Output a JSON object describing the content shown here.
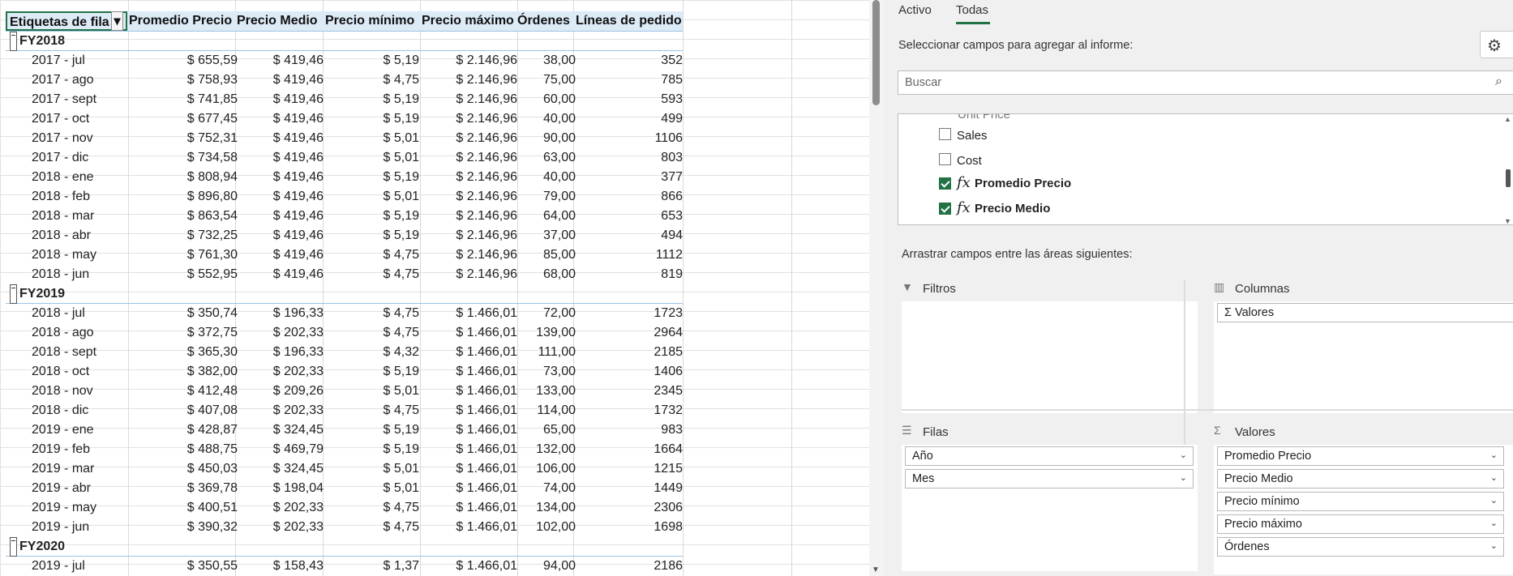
{
  "pivot": {
    "headers": [
      "Etiquetas de fila",
      "Promedio Precio",
      "Precio Medio",
      "Precio mínimo",
      "Precio máximo",
      "Órdenes",
      "Líneas de pedido"
    ],
    "rows": [
      {
        "type": "group",
        "label": "FY2018"
      },
      {
        "type": "data",
        "label": "2017 - jul",
        "c1": "$ 655,59",
        "c2": "$ 419,46",
        "c3": "$ 5,19",
        "c4": "$ 2.146,96",
        "c5": "38,00",
        "c6": "352"
      },
      {
        "type": "data",
        "label": "2017 - ago",
        "c1": "$ 758,93",
        "c2": "$ 419,46",
        "c3": "$ 4,75",
        "c4": "$ 2.146,96",
        "c5": "75,00",
        "c6": "785"
      },
      {
        "type": "data",
        "label": "2017 - sept",
        "c1": "$ 741,85",
        "c2": "$ 419,46",
        "c3": "$ 5,19",
        "c4": "$ 2.146,96",
        "c5": "60,00",
        "c6": "593"
      },
      {
        "type": "data",
        "label": "2017 - oct",
        "c1": "$ 677,45",
        "c2": "$ 419,46",
        "c3": "$ 5,19",
        "c4": "$ 2.146,96",
        "c5": "40,00",
        "c6": "499"
      },
      {
        "type": "data",
        "label": "2017 - nov",
        "c1": "$ 752,31",
        "c2": "$ 419,46",
        "c3": "$ 5,01",
        "c4": "$ 2.146,96",
        "c5": "90,00",
        "c6": "1106"
      },
      {
        "type": "data",
        "label": "2017 - dic",
        "c1": "$ 734,58",
        "c2": "$ 419,46",
        "c3": "$ 5,01",
        "c4": "$ 2.146,96",
        "c5": "63,00",
        "c6": "803"
      },
      {
        "type": "data",
        "label": "2018 - ene",
        "c1": "$ 808,94",
        "c2": "$ 419,46",
        "c3": "$ 5,19",
        "c4": "$ 2.146,96",
        "c5": "40,00",
        "c6": "377"
      },
      {
        "type": "data",
        "label": "2018 - feb",
        "c1": "$ 896,80",
        "c2": "$ 419,46",
        "c3": "$ 5,01",
        "c4": "$ 2.146,96",
        "c5": "79,00",
        "c6": "866"
      },
      {
        "type": "data",
        "label": "2018 - mar",
        "c1": "$ 863,54",
        "c2": "$ 419,46",
        "c3": "$ 5,19",
        "c4": "$ 2.146,96",
        "c5": "64,00",
        "c6": "653"
      },
      {
        "type": "data",
        "label": "2018 - abr",
        "c1": "$ 732,25",
        "c2": "$ 419,46",
        "c3": "$ 5,19",
        "c4": "$ 2.146,96",
        "c5": "37,00",
        "c6": "494"
      },
      {
        "type": "data",
        "label": "2018 - may",
        "c1": "$ 761,30",
        "c2": "$ 419,46",
        "c3": "$ 4,75",
        "c4": "$ 2.146,96",
        "c5": "85,00",
        "c6": "1112"
      },
      {
        "type": "data",
        "label": "2018 - jun",
        "c1": "$ 552,95",
        "c2": "$ 419,46",
        "c3": "$ 4,75",
        "c4": "$ 2.146,96",
        "c5": "68,00",
        "c6": "819"
      },
      {
        "type": "group",
        "label": "FY2019"
      },
      {
        "type": "data",
        "label": "2018 - jul",
        "c1": "$ 350,74",
        "c2": "$ 196,33",
        "c3": "$ 4,75",
        "c4": "$ 1.466,01",
        "c5": "72,00",
        "c6": "1723"
      },
      {
        "type": "data",
        "label": "2018 - ago",
        "c1": "$ 372,75",
        "c2": "$ 202,33",
        "c3": "$ 4,75",
        "c4": "$ 1.466,01",
        "c5": "139,00",
        "c6": "2964"
      },
      {
        "type": "data",
        "label": "2018 - sept",
        "c1": "$ 365,30",
        "c2": "$ 196,33",
        "c3": "$ 4,32",
        "c4": "$ 1.466,01",
        "c5": "111,00",
        "c6": "2185"
      },
      {
        "type": "data",
        "label": "2018 - oct",
        "c1": "$ 382,00",
        "c2": "$ 202,33",
        "c3": "$ 5,19",
        "c4": "$ 1.466,01",
        "c5": "73,00",
        "c6": "1406"
      },
      {
        "type": "data",
        "label": "2018 - nov",
        "c1": "$ 412,48",
        "c2": "$ 209,26",
        "c3": "$ 5,01",
        "c4": "$ 1.466,01",
        "c5": "133,00",
        "c6": "2345"
      },
      {
        "type": "data",
        "label": "2018 - dic",
        "c1": "$ 407,08",
        "c2": "$ 202,33",
        "c3": "$ 4,75",
        "c4": "$ 1.466,01",
        "c5": "114,00",
        "c6": "1732"
      },
      {
        "type": "data",
        "label": "2019 - ene",
        "c1": "$ 428,87",
        "c2": "$ 324,45",
        "c3": "$ 5,19",
        "c4": "$ 1.466,01",
        "c5": "65,00",
        "c6": "983"
      },
      {
        "type": "data",
        "label": "2019 - feb",
        "c1": "$ 488,75",
        "c2": "$ 469,79",
        "c3": "$ 5,19",
        "c4": "$ 1.466,01",
        "c5": "132,00",
        "c6": "1664"
      },
      {
        "type": "data",
        "label": "2019 - mar",
        "c1": "$ 450,03",
        "c2": "$ 324,45",
        "c3": "$ 5,01",
        "c4": "$ 1.466,01",
        "c5": "106,00",
        "c6": "1215"
      },
      {
        "type": "data",
        "label": "2019 - abr",
        "c1": "$ 369,78",
        "c2": "$ 198,04",
        "c3": "$ 5,01",
        "c4": "$ 1.466,01",
        "c5": "74,00",
        "c6": "1449"
      },
      {
        "type": "data",
        "label": "2019 - may",
        "c1": "$ 400,51",
        "c2": "$ 202,33",
        "c3": "$ 4,75",
        "c4": "$ 1.466,01",
        "c5": "134,00",
        "c6": "2306"
      },
      {
        "type": "data",
        "label": "2019 - jun",
        "c1": "$ 390,32",
        "c2": "$ 202,33",
        "c3": "$ 4,75",
        "c4": "$ 1.466,01",
        "c5": "102,00",
        "c6": "1698"
      },
      {
        "type": "group",
        "label": "FY2020"
      },
      {
        "type": "data",
        "label": "2019 - jul",
        "c1": "$ 350,55",
        "c2": "$ 158,43",
        "c3": "$ 1,37",
        "c4": "$ 1.466,01",
        "c5": "94,00",
        "c6": "2186"
      }
    ]
  },
  "fieldlist": {
    "tabs": [
      "Activo",
      "Todas"
    ],
    "active_tab": "Todas",
    "select_label": "Seleccionar campos para agregar al informe:",
    "search_placeholder": "Buscar",
    "partial_field": "Unit Price",
    "fields": [
      {
        "name": "Sales",
        "checked": false,
        "measure": false
      },
      {
        "name": "Cost",
        "checked": false,
        "measure": false
      },
      {
        "name": "Promedio Precio",
        "checked": true,
        "measure": true
      },
      {
        "name": "Precio Medio",
        "checked": true,
        "measure": true
      }
    ],
    "fx_symbol": "fx",
    "drag_label": "Arrastrar campos entre las áreas siguientes:",
    "areas": {
      "filters": {
        "title": "Filtros",
        "items": []
      },
      "columns": {
        "title": "Columnas",
        "items": [
          "Σ Valores"
        ]
      },
      "rows": {
        "title": "Filas",
        "items": [
          "Año",
          "Mes"
        ]
      },
      "values": {
        "title": "Valores",
        "items": [
          "Promedio Precio",
          "Precio Medio",
          "Precio mínimo",
          "Precio máximo",
          "Órdenes"
        ]
      }
    }
  },
  "icons": {
    "filter": "filter-icon",
    "columns": "columns-icon",
    "rows": "rows-icon",
    "values": "sigma-icon",
    "settings": "gear-icon",
    "search": "search-icon"
  },
  "colors": {
    "accent": "#217346",
    "header_bg": "#ddebf7",
    "header_border": "#9bc2e6"
  }
}
